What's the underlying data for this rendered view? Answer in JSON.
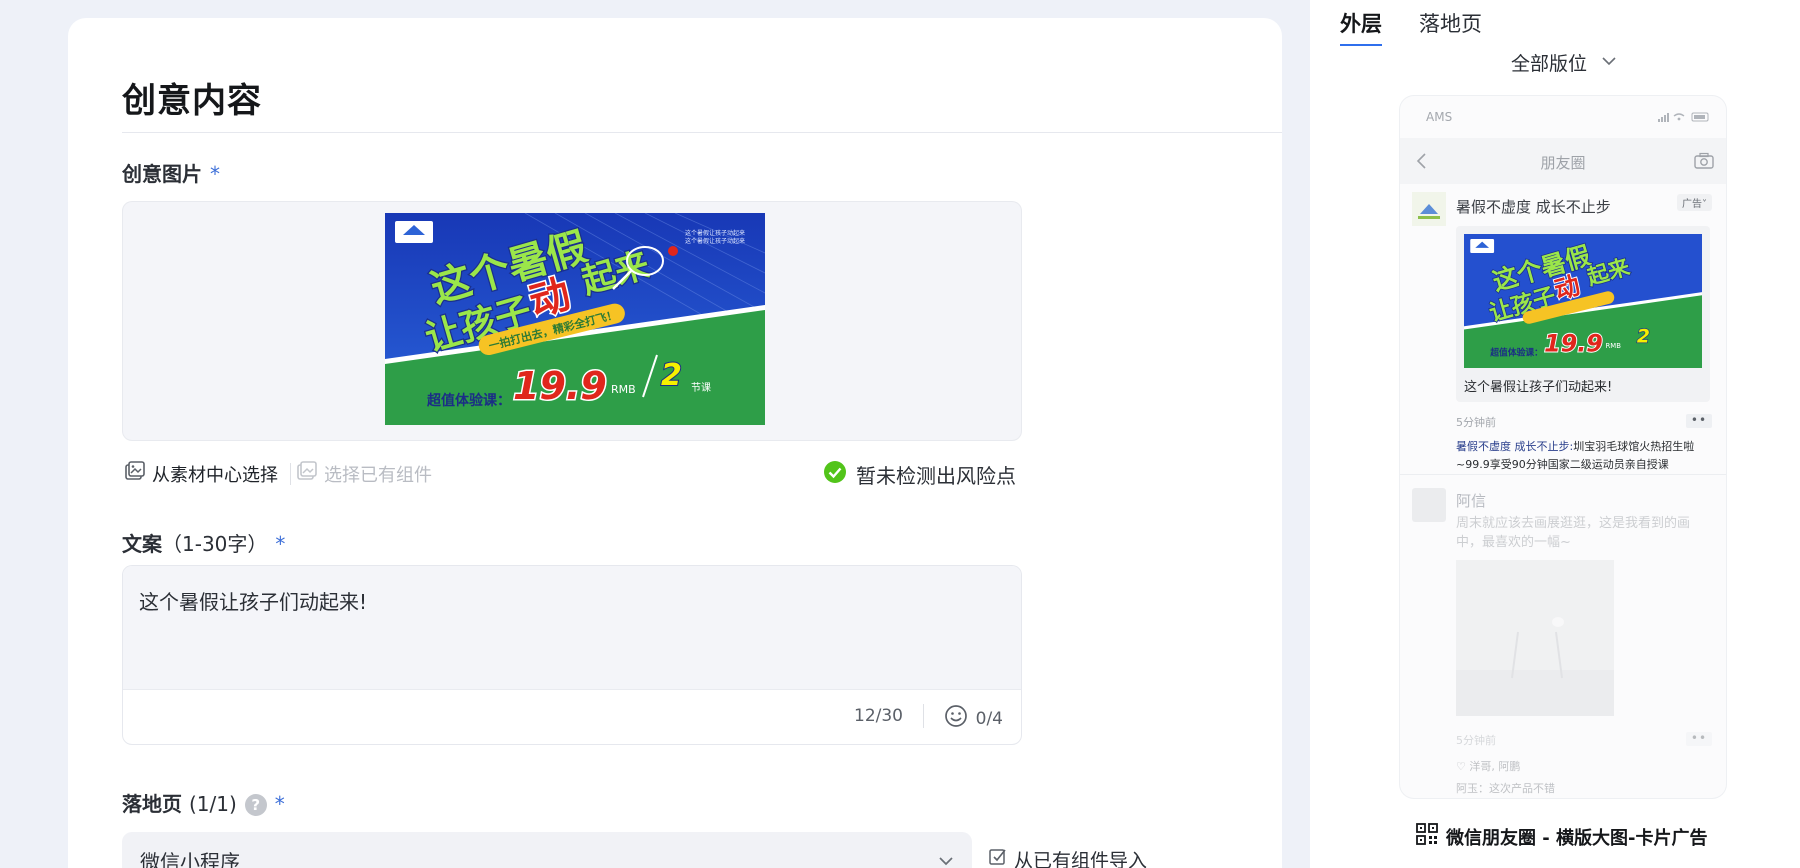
{
  "creative_section": {
    "title": "创意内容",
    "image_field": {
      "label": "创意图片",
      "required_mark": "*",
      "actions": {
        "material_center": "从素材中心选择",
        "existing_component": "选择已有组件"
      },
      "risk_status": "暂未检测出风险点"
    },
    "copy_field": {
      "label": "文案",
      "hint": "（1-30字）",
      "required_mark": "*",
      "value": "这个暑假让孩子们动起来!",
      "char_count": "12/30",
      "emoji_count": "0/4"
    },
    "landing_field": {
      "label": "落地页",
      "count": "(1/1)",
      "help_icon_glyph": "?",
      "required_mark": "*",
      "selected": "微信小程序",
      "import_label": "从已有组件导入"
    }
  },
  "creative_image": {
    "headline_line1": "这个暑假",
    "headline_line2a": "让孩子",
    "headline_line2b": "动",
    "headline_line2c": "起来",
    "banner": "一拍打出去，精彩全打飞！",
    "offer_label": "超值体验课：",
    "price": "19.9",
    "currency": "RMB",
    "lessons": "2",
    "lessons_unit": "节课",
    "corner_note": "这个暑假让孩子动起来"
  },
  "preview_panel": {
    "tabs": [
      {
        "label": "外层",
        "active": true
      },
      {
        "label": "落地页",
        "active": false
      }
    ],
    "position_select": "全部版位",
    "phone": {
      "carrier": "AMS",
      "nav_title": "朋友圈",
      "ad_post": {
        "name": "暑假不虚度 成长不止步",
        "ad_badge": "广告",
        "ad_badge_chevron": "˅",
        "caption": "这个暑假让孩子们动起来!",
        "time": "5分钟前",
        "menu_dots": "••",
        "comment_name": "暑假不虚度 成长不止步:",
        "comment_text": "圳宝羽毛球馆火热招生啦~99.9享受90分钟国家二级运动员亲自授课"
      },
      "friend_post": {
        "name": "阿信",
        "text": "周末就应该去画展逛逛，这是我看到的画中，最喜欢的一幅~",
        "time": "5分钟前",
        "menu_dots": "••",
        "likes": "♡ 洋哥, 阿鹏",
        "reply": "阿玉：这次产品不错"
      }
    },
    "caption": "微信朋友圈 - 横版大图-卡片广告"
  },
  "colors": {
    "accent_blue": "#2f6fed",
    "required_star": "#3d6fd8",
    "ok_green": "#52c41a",
    "creative_blue": "#1f48c9",
    "creative_green": "#2e9e48",
    "price_red": "#e0261c"
  }
}
